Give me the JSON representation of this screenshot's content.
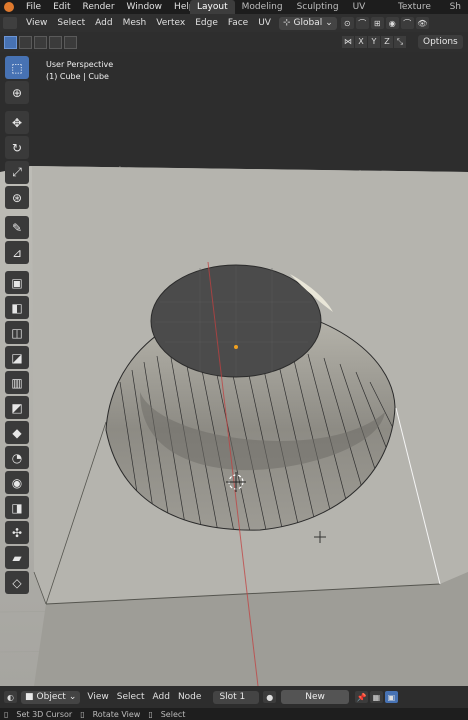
{
  "topbar": {
    "menus": [
      "File",
      "Edit",
      "Render",
      "Window",
      "Help"
    ],
    "workspaces": [
      "Layout",
      "Modeling",
      "Sculpting",
      "UV Editing",
      "Texture Paint",
      "Sh"
    ],
    "active_workspace": "Layout"
  },
  "header": {
    "menus": [
      "View",
      "Select",
      "Add",
      "Mesh",
      "Vertex",
      "Edge",
      "Face",
      "UV"
    ],
    "orientation": "Global"
  },
  "tool_header": {
    "axes": [
      "X",
      "Y",
      "Z"
    ],
    "options_label": "Options"
  },
  "viewport": {
    "perspective_label": "User Perspective",
    "object_label": "(1) Cube | Cube"
  },
  "toolbar": {
    "tools": [
      "select-box",
      "cursor",
      "move",
      "rotate",
      "scale",
      "transform",
      "annotate",
      "measure",
      "add-cube",
      "extrude-region",
      "inset-faces",
      "bevel",
      "loop-cut",
      "knife",
      "poly-build",
      "spin",
      "smooth",
      "edge-slide",
      "shrink-fatten",
      "shear",
      "rip-region"
    ]
  },
  "statusbar": {
    "mode": "Object",
    "menus": [
      "View",
      "Select",
      "Add",
      "Node"
    ],
    "slot": "Slot 1",
    "new_label": "New"
  },
  "footer": {
    "hints": [
      "Set 3D Cursor",
      "Rotate View",
      "Select"
    ]
  },
  "colors": {
    "accent": "#4772b3",
    "viewport_bg": "#2d2d2d",
    "surface": "#b4b3ad"
  }
}
